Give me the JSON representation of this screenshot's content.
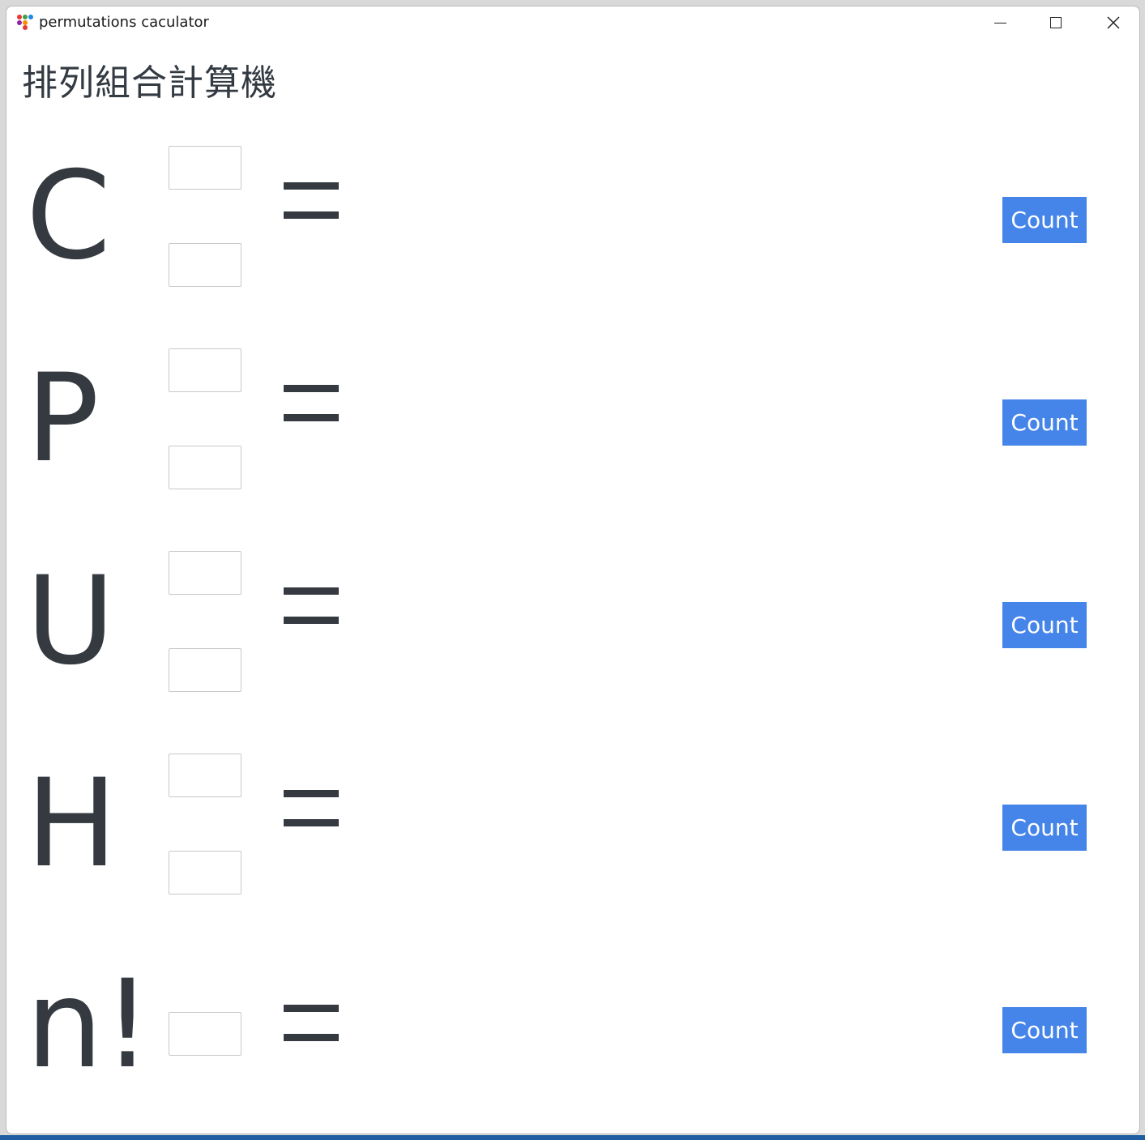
{
  "window": {
    "title": "permutations caculator"
  },
  "page": {
    "heading": "排列組合計算機"
  },
  "rows": [
    {
      "symbol": "C",
      "button_label": "Count",
      "result": ""
    },
    {
      "symbol": "P",
      "button_label": "Count",
      "result": ""
    },
    {
      "symbol": "U",
      "button_label": "Count",
      "result": ""
    },
    {
      "symbol": "H",
      "button_label": "Count",
      "result": ""
    },
    {
      "symbol": "n!",
      "button_label": "Count",
      "result": ""
    }
  ],
  "colors": {
    "button_bg": "#4584e9",
    "text": "#343a40"
  },
  "icons": {
    "app": "app-dots-icon",
    "minimize": "minimize-icon",
    "maximize": "maximize-icon",
    "close": "close-icon"
  }
}
